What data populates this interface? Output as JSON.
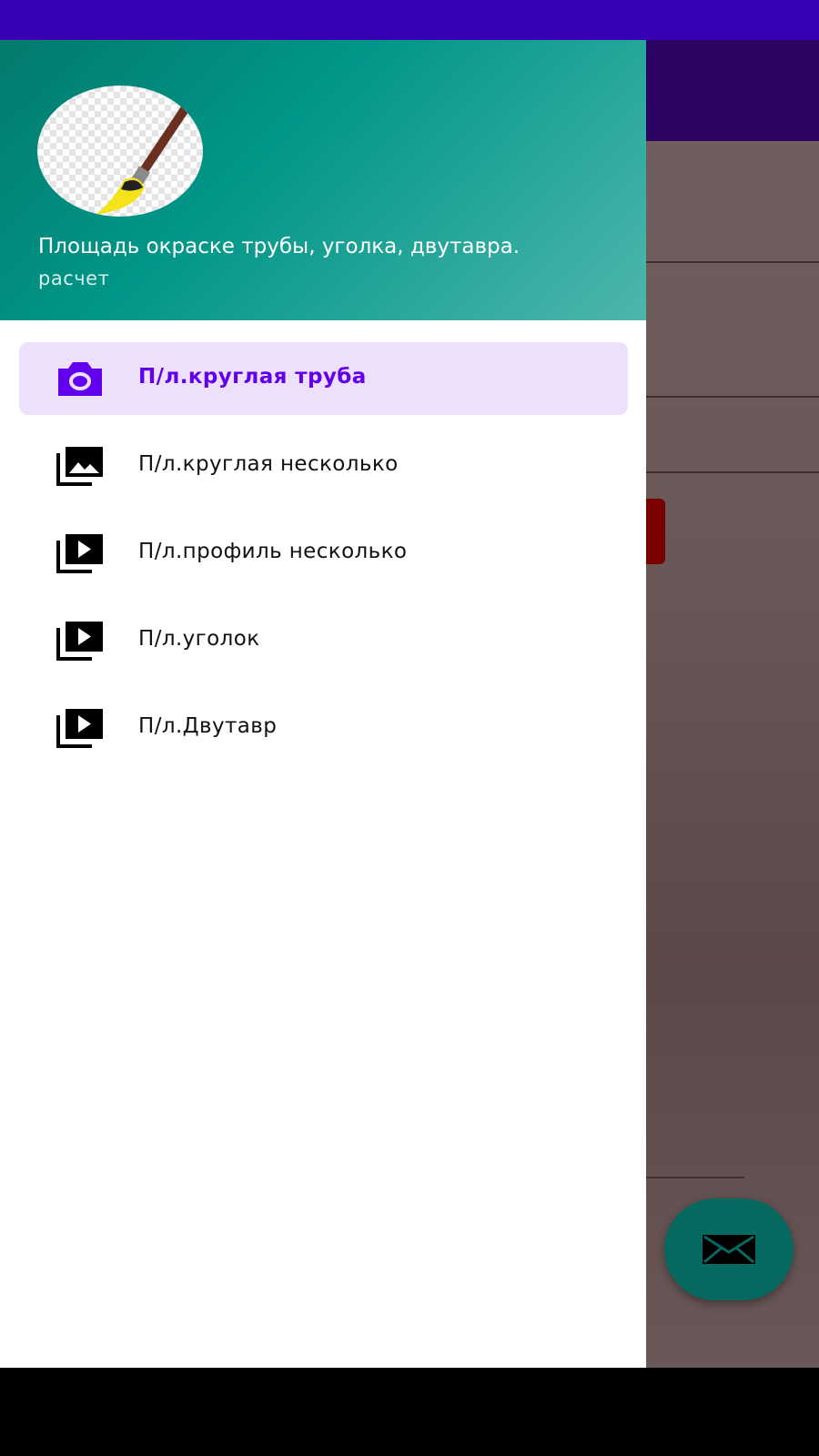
{
  "header": {
    "title": "Площадь окраске трубы, уголка, двутавра.",
    "subtitle": "расчет",
    "avatar_icon": "paintbrush-icon"
  },
  "nav": {
    "items": [
      {
        "label": "П/л.круглая труба",
        "icon": "camera-icon",
        "active": true
      },
      {
        "label": "П/л.круглая несколько",
        "icon": "photo-library-icon",
        "active": false
      },
      {
        "label": "П/л.профиль несколько",
        "icon": "video-library-icon",
        "active": false
      },
      {
        "label": "П/л.уголок",
        "icon": "video-library-icon",
        "active": false
      },
      {
        "label": "П/л.Двутавр",
        "icon": "video-library-icon",
        "active": false
      }
    ]
  },
  "fab": {
    "icon": "mail-icon"
  },
  "colors": {
    "status_bar": "#3700b3",
    "toolbar": "#2a0363",
    "header_gradient_start": "#037a6c",
    "header_gradient_end": "#4db6ac",
    "active_item_bg": "#ede0fa",
    "active_item_fg": "#6200ee",
    "fab": "#066960"
  }
}
